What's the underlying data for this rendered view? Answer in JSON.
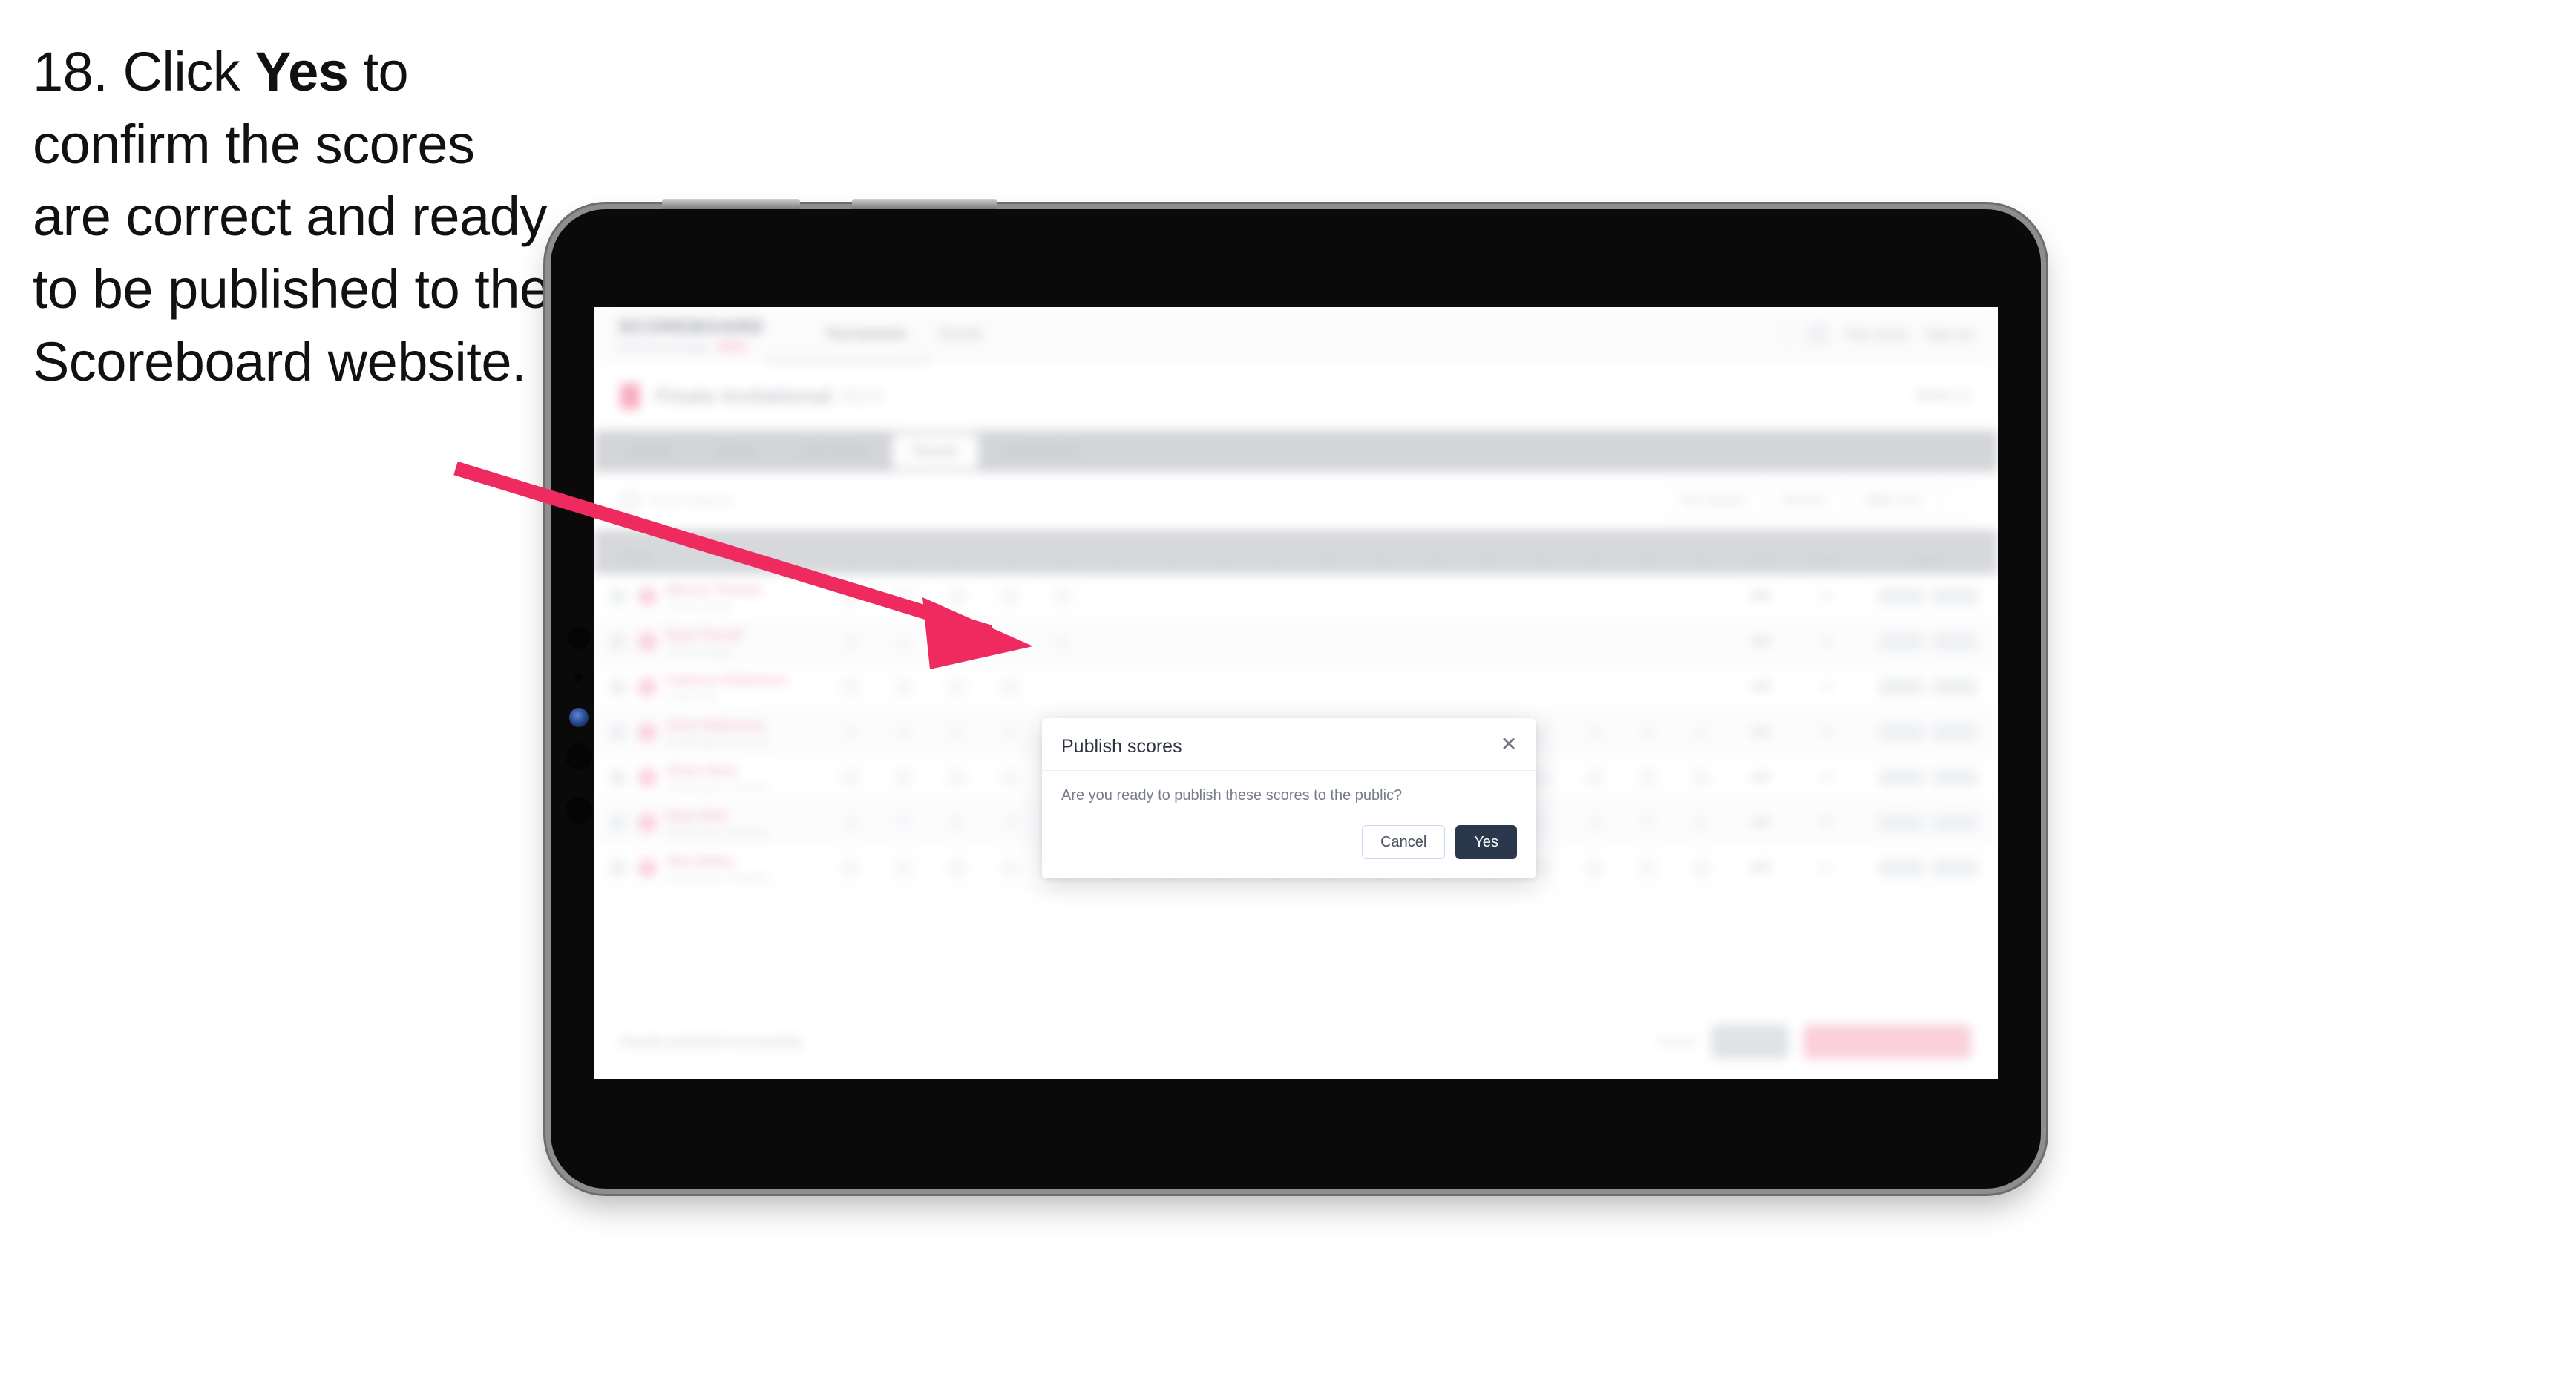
{
  "instruction": {
    "number": "18.",
    "pre": "Click",
    "bold": "Yes",
    "post": "to confirm the scores are correct and ready to be published to the Scoreboard website."
  },
  "colors": {
    "arrow": "#ef2a5e",
    "brand_pink": "#f7a8bd",
    "yes_button": "#2b374b",
    "cancel_border": "#c9d8f0",
    "device_body": "#0a0a0a",
    "device_bezel": "#8e8e8e"
  },
  "app": {
    "brand": {
      "word": "SCOREBOARD",
      "sub": "powered by dartsapp",
      "badge": "BETA"
    },
    "nav": [
      {
        "label": "Tournaments"
      },
      {
        "label": "Events"
      }
    ],
    "header_right": {
      "avatar_icon": "avatar-icon",
      "user_label": "Tony Jones",
      "signout_label": "Sign out"
    },
    "competition": {
      "flag_icon": "flag-icon",
      "title": "Finals Invitational",
      "subtitle": "2024",
      "right_label": "Week 12"
    },
    "tabs": [
      {
        "label": "Details",
        "active": false
      },
      {
        "label": "Draws",
        "active": false
      },
      {
        "label": "Live Scores",
        "active": false
      },
      {
        "label": "Results",
        "active": true
      },
      {
        "label": "Leaderboard",
        "active": false
      }
    ],
    "filters": {
      "search_placeholder": "Search players",
      "controls": [
        {
          "label": "This Season",
          "icon": "chevron-down-icon"
        },
        {
          "label": "Round 1",
          "icon": "chevron-down-icon"
        },
        {
          "label": "Table Only",
          "icon": "chevron-down-icon"
        },
        {
          "label": "",
          "icon": "filter-icon"
        }
      ]
    },
    "table": {
      "columns": [
        {
          "label": "Player",
          "type": "player"
        },
        {
          "label": "1",
          "type": "num"
        },
        {
          "label": "2",
          "type": "num"
        },
        {
          "label": "3",
          "type": "num"
        },
        {
          "label": "4",
          "type": "num"
        },
        {
          "label": "5",
          "type": "num"
        },
        {
          "label": "6",
          "type": "num"
        },
        {
          "label": "7",
          "type": "num"
        },
        {
          "label": "8",
          "type": "num"
        },
        {
          "label": "9",
          "type": "num"
        },
        {
          "label": "10",
          "type": "num"
        },
        {
          "label": "11",
          "type": "num"
        },
        {
          "label": "12",
          "type": "num"
        },
        {
          "label": "13",
          "type": "num"
        },
        {
          "label": "14",
          "type": "num"
        },
        {
          "label": "15",
          "type": "num"
        },
        {
          "label": "16",
          "type": "num"
        },
        {
          "label": "17",
          "type": "num"
        },
        {
          "label": "Total",
          "type": "total"
        },
        {
          "label": "Points",
          "type": "points"
        },
        {
          "label": "Actions",
          "type": "actions"
        }
      ],
      "rows": [
        {
          "name": "Marcus Thomas",
          "club": "Central College",
          "scores": [
            "0",
            "0",
            "0",
            "0",
            "0",
            "",
            "",
            "",
            "",
            "",
            "",
            "",
            "",
            "",
            "",
            "",
            ""
          ],
          "total": "180",
          "points": "10"
        },
        {
          "name": "Ryan Parnell",
          "club": "Central College",
          "scores": [
            "0",
            "0",
            "0",
            "0",
            "0",
            "",
            "",
            "",
            "",
            "",
            "",
            "",
            "",
            "",
            "",
            "",
            ""
          ],
          "total": "168",
          "points": "12"
        },
        {
          "name": "Cameron Robertson",
          "club": "Parker Park",
          "scores": [
            "0",
            "0",
            "0",
            "0",
            "",
            "",
            "",
            "",
            "",
            "",
            "",
            "",
            "",
            "",
            "",
            "",
            ""
          ],
          "total": "156",
          "points": "14"
        },
        {
          "name": "Chris Robertson",
          "club": "Southampton University",
          "scores": [
            "0",
            "0",
            "0",
            "0",
            "0",
            "0",
            "0",
            "0",
            "0",
            "0",
            "0",
            "0",
            "0",
            "0",
            "0",
            "0",
            "0"
          ],
          "total": "144",
          "points": "16"
        },
        {
          "name": "Oliver Reed",
          "club": "Southampton University",
          "scores": [
            "0",
            "0",
            "0",
            "0",
            "0",
            "0",
            "0",
            "0",
            "0",
            "0",
            "0",
            "0",
            "0",
            "0",
            "0",
            "0",
            "0"
          ],
          "total": "132",
          "points": "18"
        },
        {
          "name": "Ryan Britt",
          "club": "Southampton University",
          "scores": [
            "0",
            "0",
            "0",
            "0",
            "0",
            "0",
            "0",
            "0",
            "0",
            "0",
            "0",
            "0",
            "0",
            "0",
            "0",
            "0",
            "0"
          ],
          "total": "120",
          "points": "20"
        },
        {
          "name": "Nick Bailey",
          "club": "Southampton University",
          "scores": [
            "0",
            "0",
            "0",
            "0",
            "0",
            "0",
            "0",
            "0",
            "0",
            "0",
            "0",
            "0",
            "0",
            "0",
            "0",
            "0",
            "0"
          ],
          "total": "108",
          "points": "22"
        }
      ],
      "action_labels": [
        "Edit",
        "View"
      ]
    },
    "bottom": {
      "note": "Results published successfully",
      "link": "Cancel",
      "secondary_label": "Save",
      "primary_label": "Publish scores to public"
    }
  },
  "modal": {
    "title": "Publish scores",
    "close_icon": "close-icon",
    "message": "Are you ready to publish these scores to the public?",
    "cancel_label": "Cancel",
    "yes_label": "Yes"
  }
}
